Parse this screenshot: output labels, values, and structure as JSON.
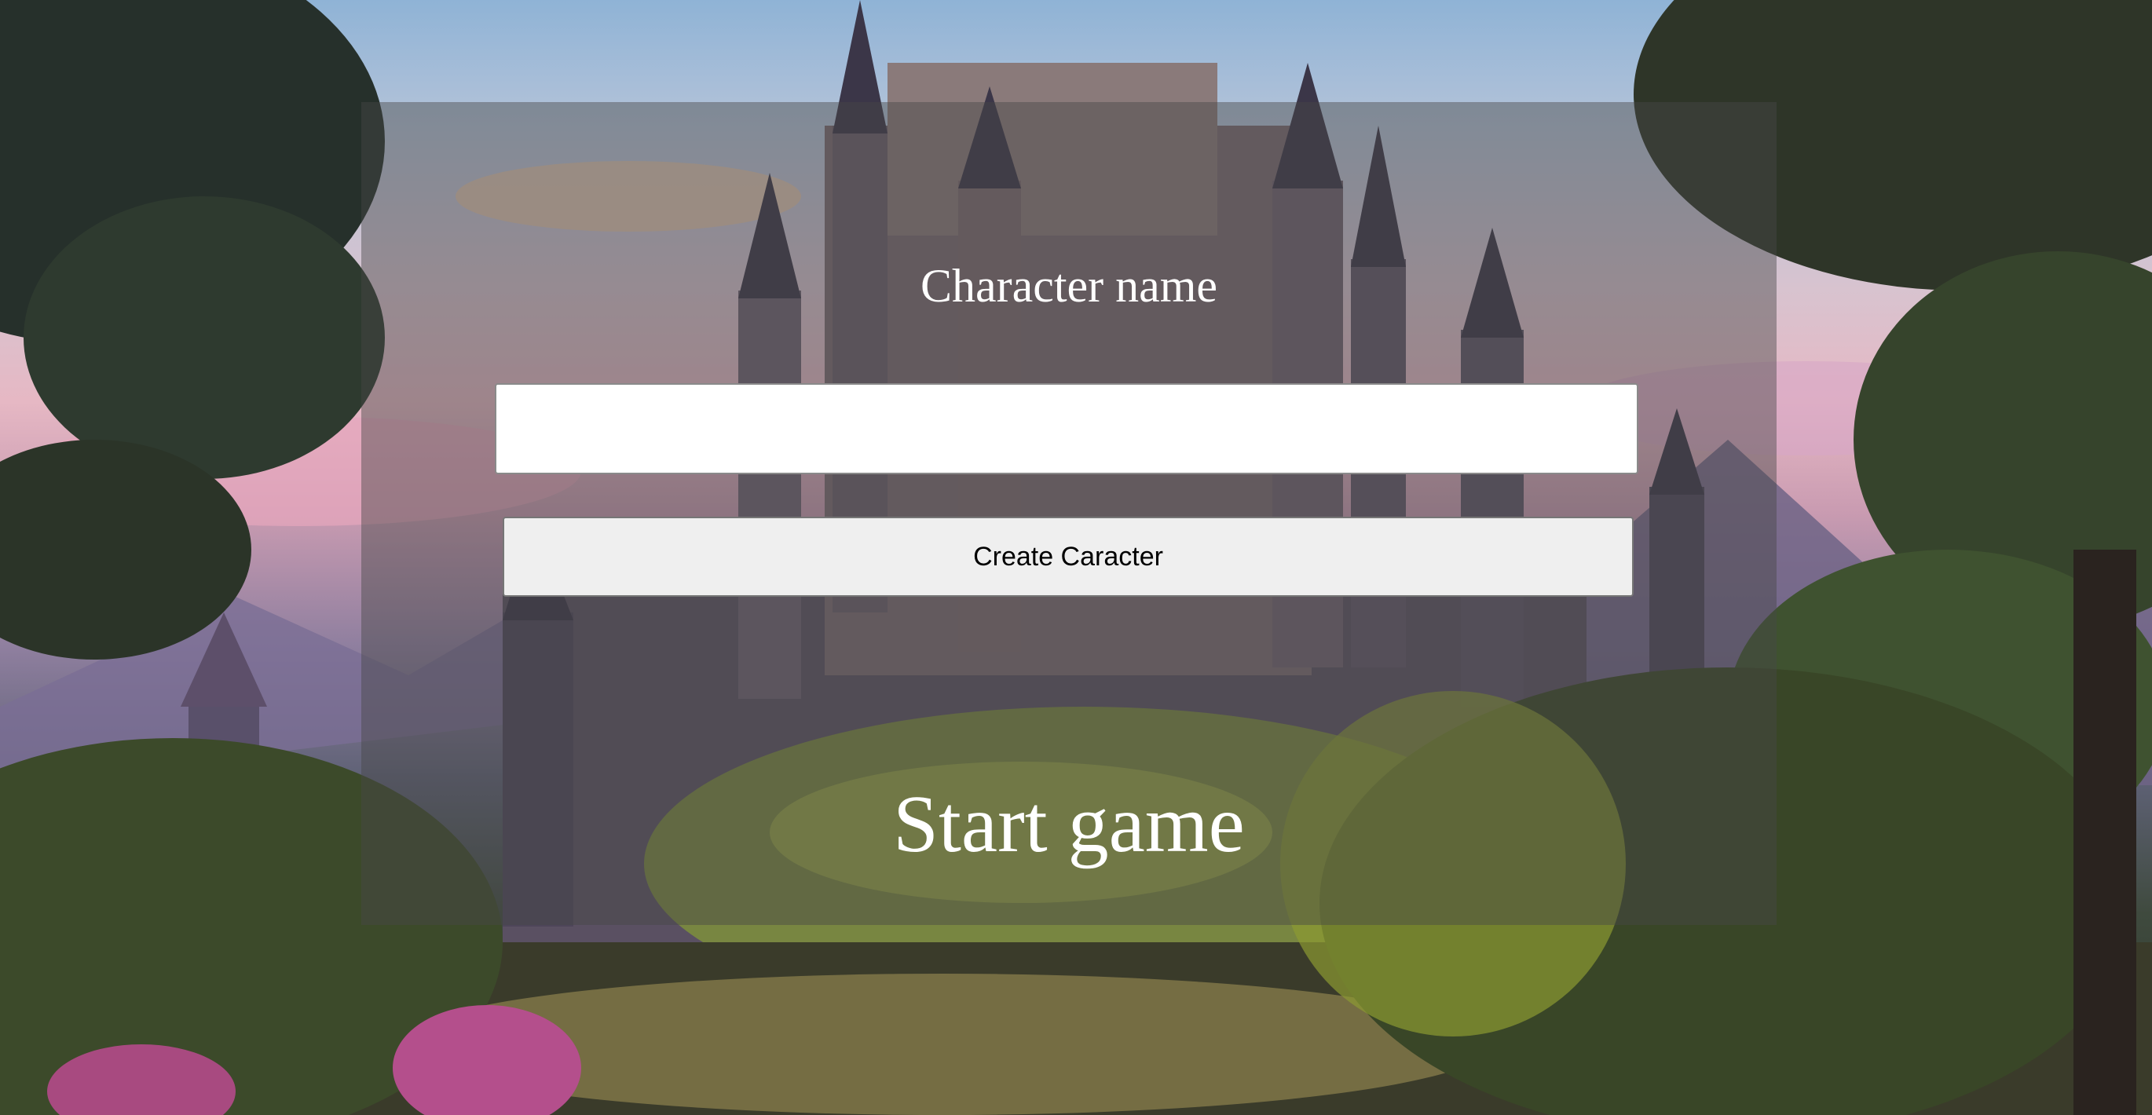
{
  "form": {
    "title": "Character name",
    "name_value": "",
    "name_placeholder": "",
    "create_button_label": "Create Caracter",
    "start_link_label": "Start game"
  },
  "background": {
    "description_icon": "castle-landscape-illustration"
  },
  "colors": {
    "panel_overlay": "#464646",
    "text": "#ffffff",
    "button_bg": "#efefef"
  }
}
